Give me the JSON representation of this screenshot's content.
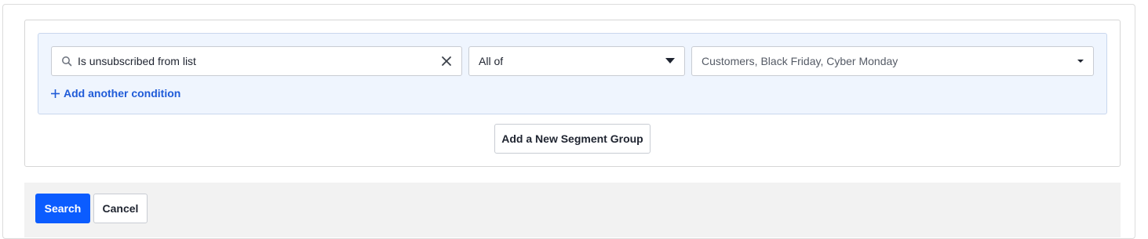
{
  "segment_builder": {
    "condition": {
      "value": "Is unsubscribed from list",
      "icon": "search-icon",
      "clear_icon": "close-icon"
    },
    "operator": {
      "selected": "All of",
      "icon": "caret-down-icon"
    },
    "lists": {
      "selected": "Customers, Black Friday, Cyber Monday",
      "icon": "caret-down-icon"
    },
    "add_condition_label": "Add another condition",
    "add_group_label": "Add a New Segment Group"
  },
  "footer": {
    "search_label": "Search",
    "cancel_label": "Cancel"
  },
  "colors": {
    "primary": "#0b5cff",
    "link": "#1f5bd8",
    "group_background": "#eff5fe",
    "footer_background": "#f2f2f2"
  }
}
